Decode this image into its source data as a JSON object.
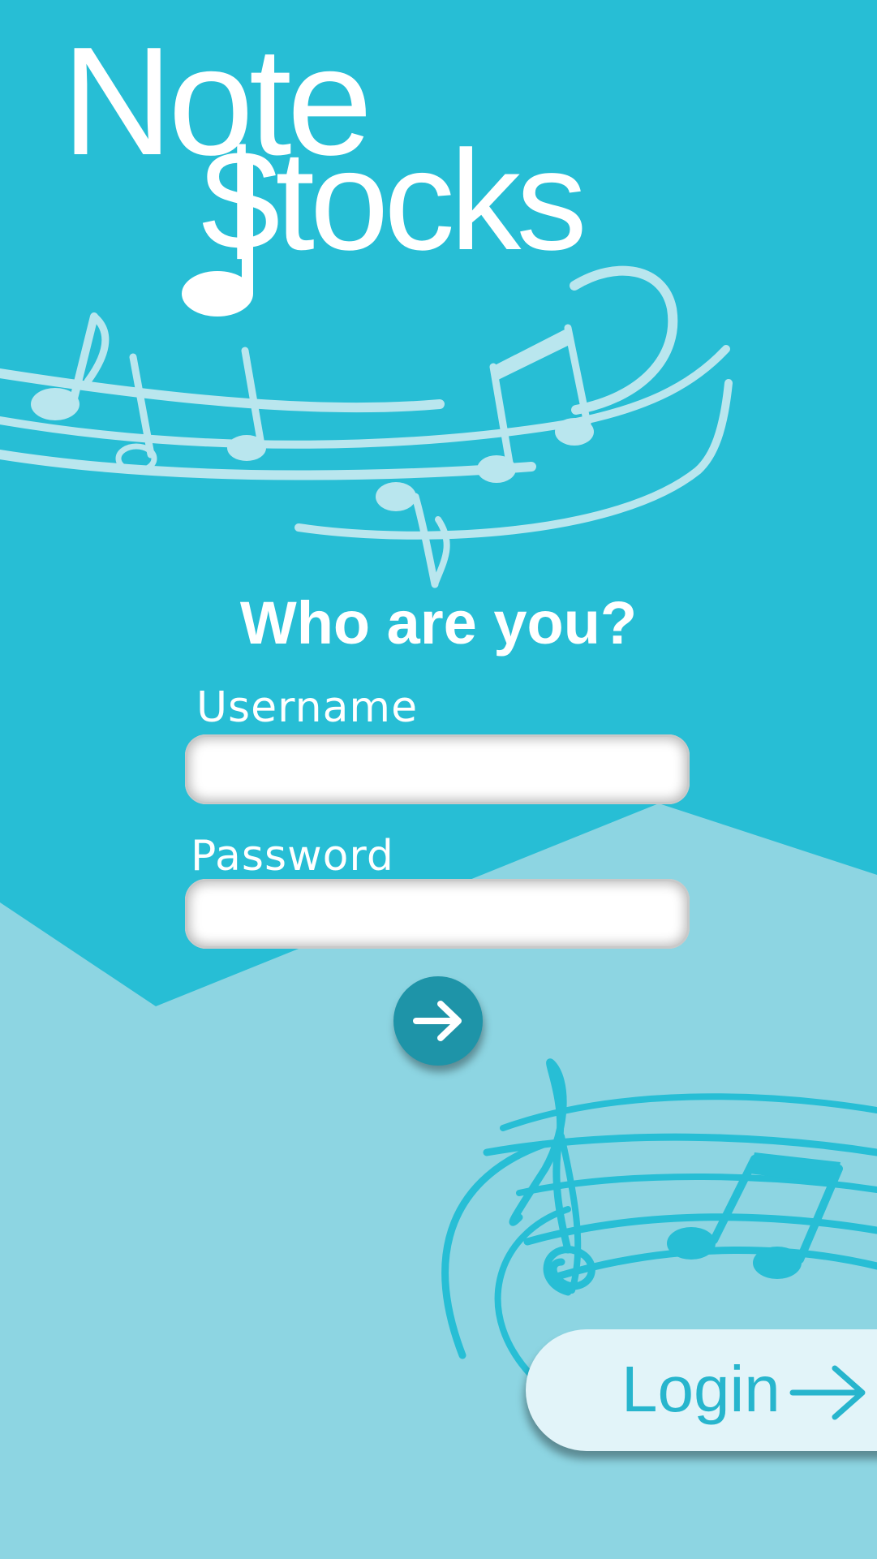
{
  "app": {
    "logo_line1": "Note",
    "logo_line2": "$tocks"
  },
  "login_form": {
    "heading": "Who are you?",
    "username_label": "Username",
    "username_value": "",
    "password_label": "Password",
    "password_value": "",
    "submit_icon": "arrow-right-icon"
  },
  "login_button": {
    "label": "Login",
    "icon": "arrow-right-icon"
  },
  "colors": {
    "top_background": "#27bed5",
    "bottom_background": "#8dd5e2",
    "staff_light": "#b9e6ee",
    "staff_teal": "#27bed5",
    "submit_button": "#1e94a8",
    "login_button_bg": "#e2f4f9",
    "login_button_text": "#27b5cd"
  }
}
